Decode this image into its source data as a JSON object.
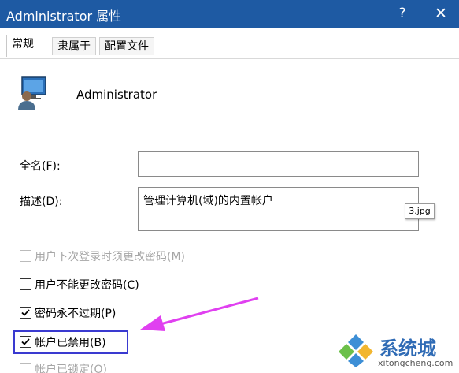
{
  "window": {
    "title": "Administrator 属性",
    "help_label": "?",
    "close_label": "✕"
  },
  "tabs": [
    {
      "label": "常规",
      "active": true
    },
    {
      "label": "隶属于",
      "active": false
    },
    {
      "label": "配置文件",
      "active": false
    }
  ],
  "user": {
    "name": "Administrator",
    "icon": "user-account-icon"
  },
  "fields": {
    "fullname": {
      "label": "全名(F):",
      "value": ""
    },
    "description": {
      "label": "描述(D):",
      "value": "管理计算机(域)的内置帐户"
    }
  },
  "checkboxes": [
    {
      "label": "用户下次登录时须更改密码(M)",
      "checked": false,
      "enabled": false
    },
    {
      "label": "用户不能更改密码(C)",
      "checked": false,
      "enabled": true
    },
    {
      "label": "密码永不过期(P)",
      "checked": true,
      "enabled": true
    },
    {
      "label": "帐户已禁用(B)",
      "checked": true,
      "enabled": true
    },
    {
      "label": "帐户已锁定(O)",
      "checked": false,
      "enabled": false
    }
  ],
  "tooltip": "3.jpg",
  "watermark": {
    "brand": "系统城",
    "domain": "xitongcheng.com"
  },
  "colors": {
    "titlebar": "#1e5aa3",
    "highlight_box": "#3a3ad0",
    "annotation_arrow": "#e040f0"
  }
}
